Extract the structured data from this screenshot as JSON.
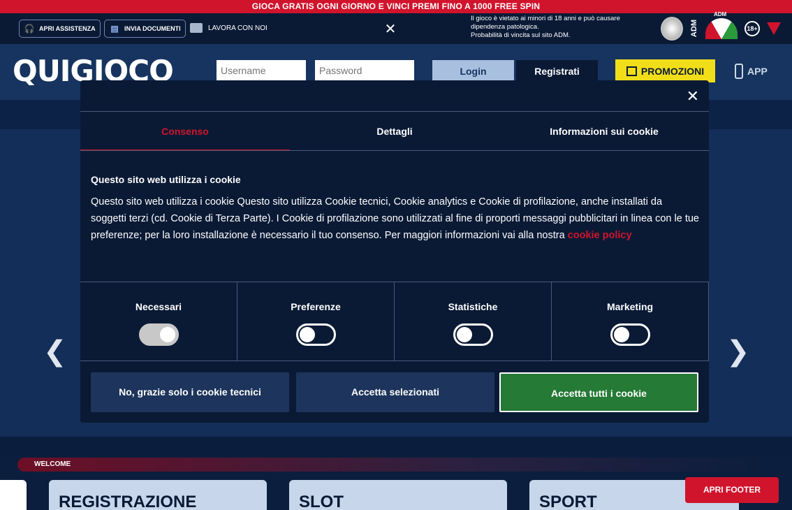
{
  "promo_strip": "GIOCA GRATIS OGNI GIORNO E VINCI PREMI FINO A 1000 FREE SPIN",
  "topbar": {
    "apri_assistenza": "APRI ASSISTENZA",
    "invia_documenti": "INVIA DOCUMENTI",
    "lavora_con_noi": "LAVORA CON NOI",
    "close": "✕",
    "warning_line1": "Il gioco è vietato ai minori di 18 anni e può causare",
    "warning_line2": "dipendenza patologica.",
    "warning_line3": "Probabilità di vincita sul sito ADM.",
    "adm_vertical": "ADM",
    "adm_gauge": "ADM",
    "age": "18+"
  },
  "header": {
    "logo": "QUIGIOCO",
    "username_placeholder": "Username",
    "password_placeholder": "Password",
    "login": "Login",
    "register": "Registrati",
    "promotions": "PROMOZIONI",
    "app": "APP"
  },
  "modal": {
    "close": "✕",
    "tabs": [
      {
        "label": "Consenso",
        "active": true
      },
      {
        "label": "Dettagli",
        "active": false
      },
      {
        "label": "Informazioni sui cookie",
        "active": false
      }
    ],
    "title": "Questo sito web utilizza i cookie",
    "body": "Questo sito web utilizza i cookie Questo sito utilizza Cookie tecnici, Cookie analytics e Cookie di profilazione, anche installati da soggetti terzi (cd. Cookie di Terza Parte). I Cookie di profilazione sono utilizzati al fine di proporti messaggi pubblicitari in linea con le tue preferenze; per la loro installazione è necessario il tuo consenso. Per maggiori informazioni vai alla nostra",
    "policy_link": "cookie policy",
    "categories": [
      {
        "label": "Necessari",
        "on": true
      },
      {
        "label": "Preferenze",
        "on": false
      },
      {
        "label": "Statistiche",
        "on": false
      },
      {
        "label": "Marketing",
        "on": false
      }
    ],
    "btn_decline": "No, grazie solo i cookie tecnici",
    "btn_selected": "Accetta selezionati",
    "btn_all": "Accetta tutti i cookie"
  },
  "hero": {
    "prev": "❮",
    "next": "❯"
  },
  "section": {
    "welcome": "WELCOME"
  },
  "cards": [
    {
      "label": "REGISTRAZIONE"
    },
    {
      "label": "SLOT"
    },
    {
      "label": "SPORT"
    }
  ],
  "footer_button": "APRI FOOTER",
  "colors": {
    "brand_red": "#d0142c",
    "navy": "#0a1a35",
    "promo_yellow": "#f2de18",
    "accept_green": "#257a35",
    "button_blue": "#1d355c"
  }
}
